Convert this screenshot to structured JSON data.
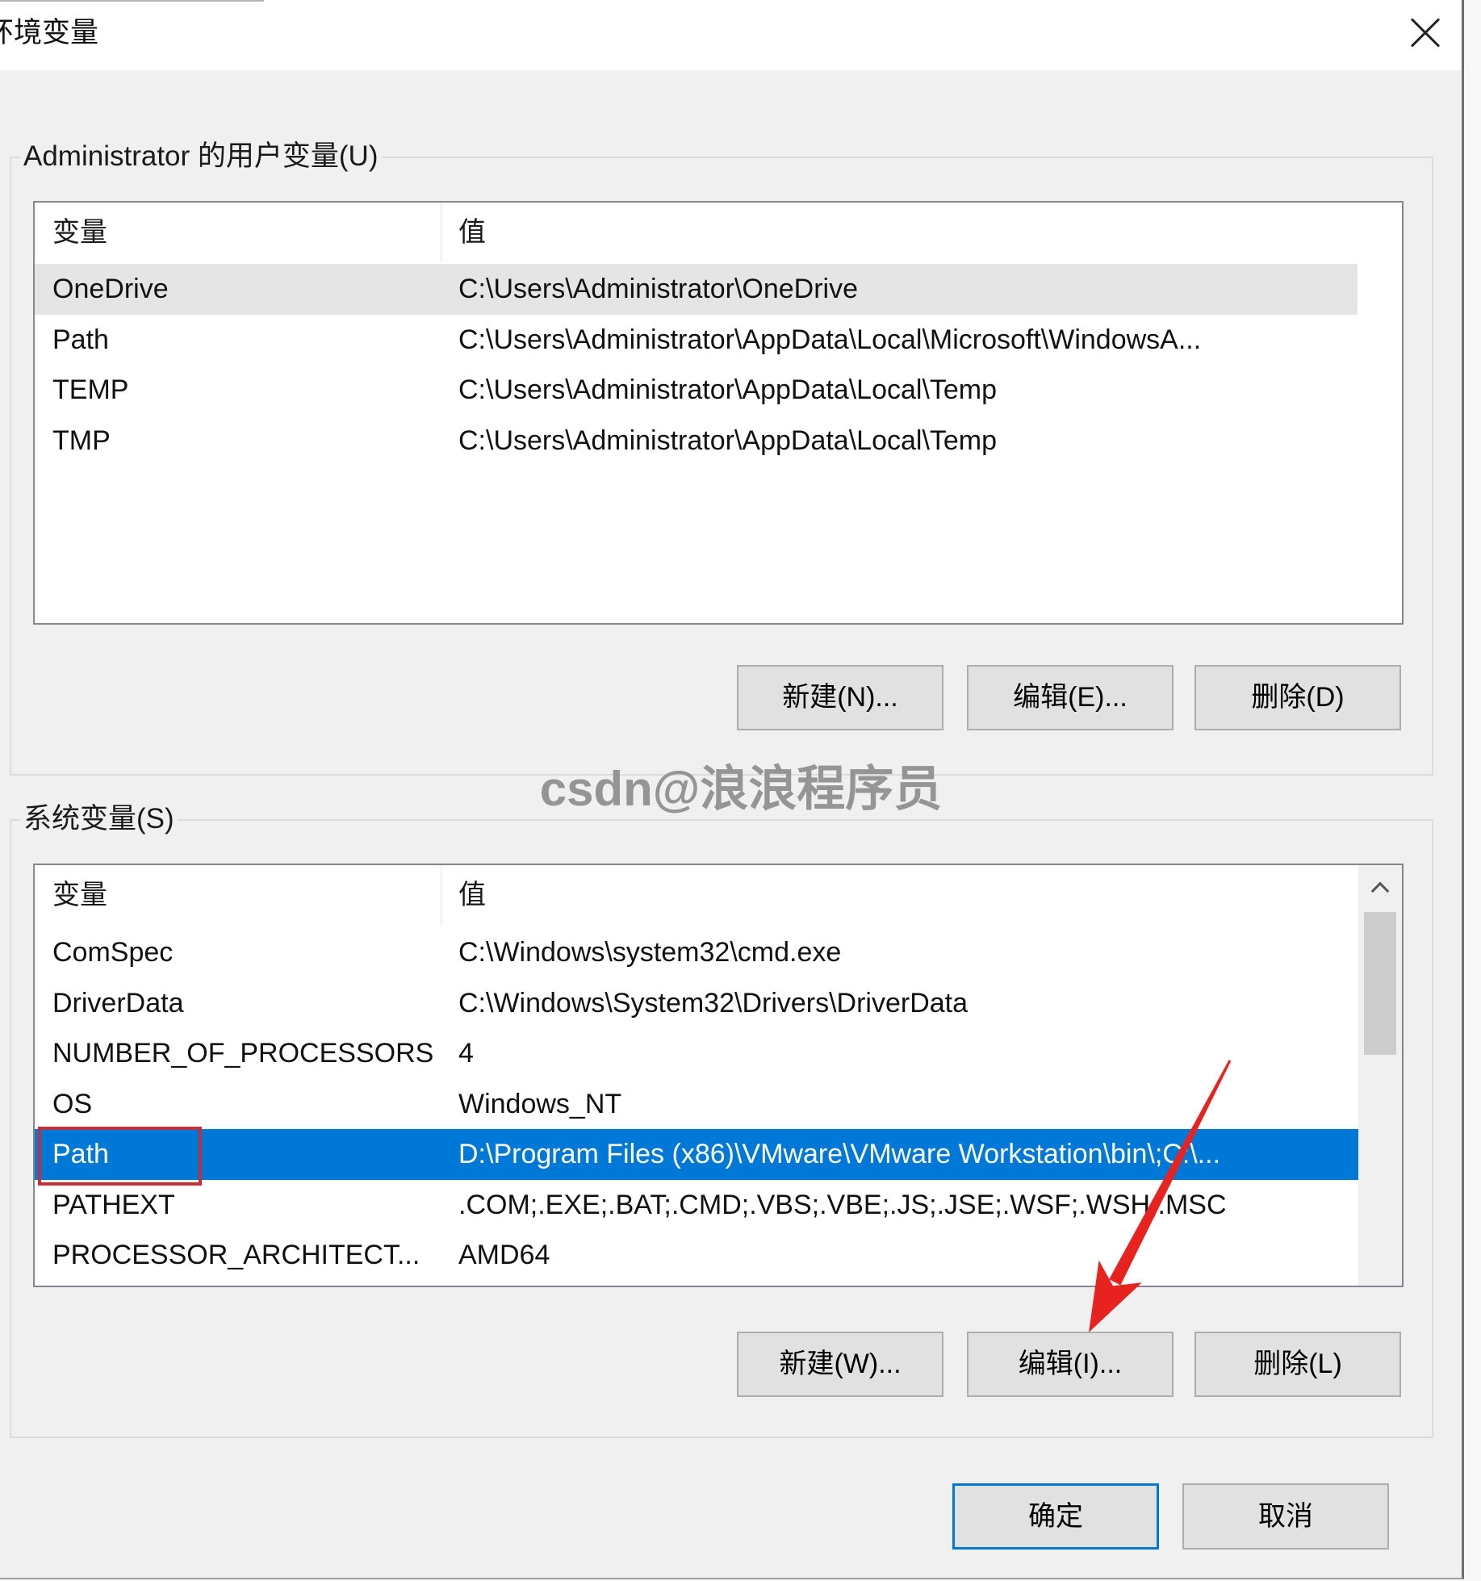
{
  "window": {
    "title": "环境变量"
  },
  "icons": {
    "close": "close-icon",
    "scroll_up": "chevron-up-icon"
  },
  "colors": {
    "selection": "#0078d7",
    "inactive_selection": "#e5e5e5",
    "annotation_arrow": "#e8231f",
    "annotation_box": "#c0303a",
    "watermark": "#8c8c8c"
  },
  "user_vars": {
    "label": "Administrator 的用户变量(U)",
    "columns": [
      "变量",
      "值"
    ],
    "selected_row": 0,
    "rows": [
      {
        "name": "OneDrive",
        "value": "C:\\Users\\Administrator\\OneDrive"
      },
      {
        "name": "Path",
        "value": "C:\\Users\\Administrator\\AppData\\Local\\Microsoft\\WindowsA..."
      },
      {
        "name": "TEMP",
        "value": "C:\\Users\\Administrator\\AppData\\Local\\Temp"
      },
      {
        "name": "TMP",
        "value": "C:\\Users\\Administrator\\AppData\\Local\\Temp"
      }
    ],
    "buttons": {
      "new": "新建(N)...",
      "edit": "编辑(E)...",
      "delete": "删除(D)"
    }
  },
  "watermark": "csdn@浪浪程序员",
  "system_vars": {
    "label": "系统变量(S)",
    "columns": [
      "变量",
      "值"
    ],
    "selected_row": 4,
    "rows": [
      {
        "name": "ComSpec",
        "value": "C:\\Windows\\system32\\cmd.exe"
      },
      {
        "name": "DriverData",
        "value": "C:\\Windows\\System32\\Drivers\\DriverData"
      },
      {
        "name": "NUMBER_OF_PROCESSORS",
        "value": "4"
      },
      {
        "name": "OS",
        "value": "Windows_NT"
      },
      {
        "name": "Path",
        "value": "D:\\Program Files (x86)\\VMware\\VMware Workstation\\bin\\;C:\\..."
      },
      {
        "name": "PATHEXT",
        "value": ".COM;.EXE;.BAT;.CMD;.VBS;.VBE;.JS;.JSE;.WSF;.WSH;.MSC"
      },
      {
        "name": "PROCESSOR_ARCHITECT...",
        "value": "AMD64"
      }
    ],
    "buttons": {
      "new": "新建(W)...",
      "edit": "编辑(I)...",
      "delete": "删除(L)"
    }
  },
  "dialog_buttons": {
    "ok": "确定",
    "cancel": "取消"
  }
}
